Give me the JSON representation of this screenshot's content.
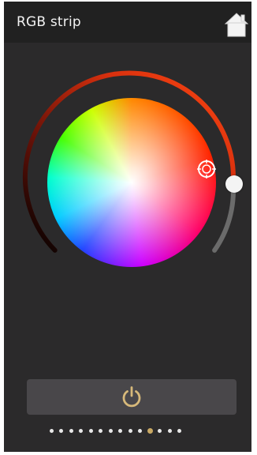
{
  "app": {
    "title": "RGB strip"
  },
  "icons": {
    "home": "home-icon",
    "power": "power-icon",
    "selector": "target-icon"
  },
  "colors": {
    "background": "#2b2a2b",
    "header_background": "#212121",
    "accent": "#c9a964",
    "arc_active": "#ff3a12",
    "arc_inactive": "#6b6b6b",
    "power_button_background": "#49474a"
  },
  "brightness": {
    "level": 0.75
  },
  "pager": {
    "total_pages": 14,
    "active_page": 11
  }
}
